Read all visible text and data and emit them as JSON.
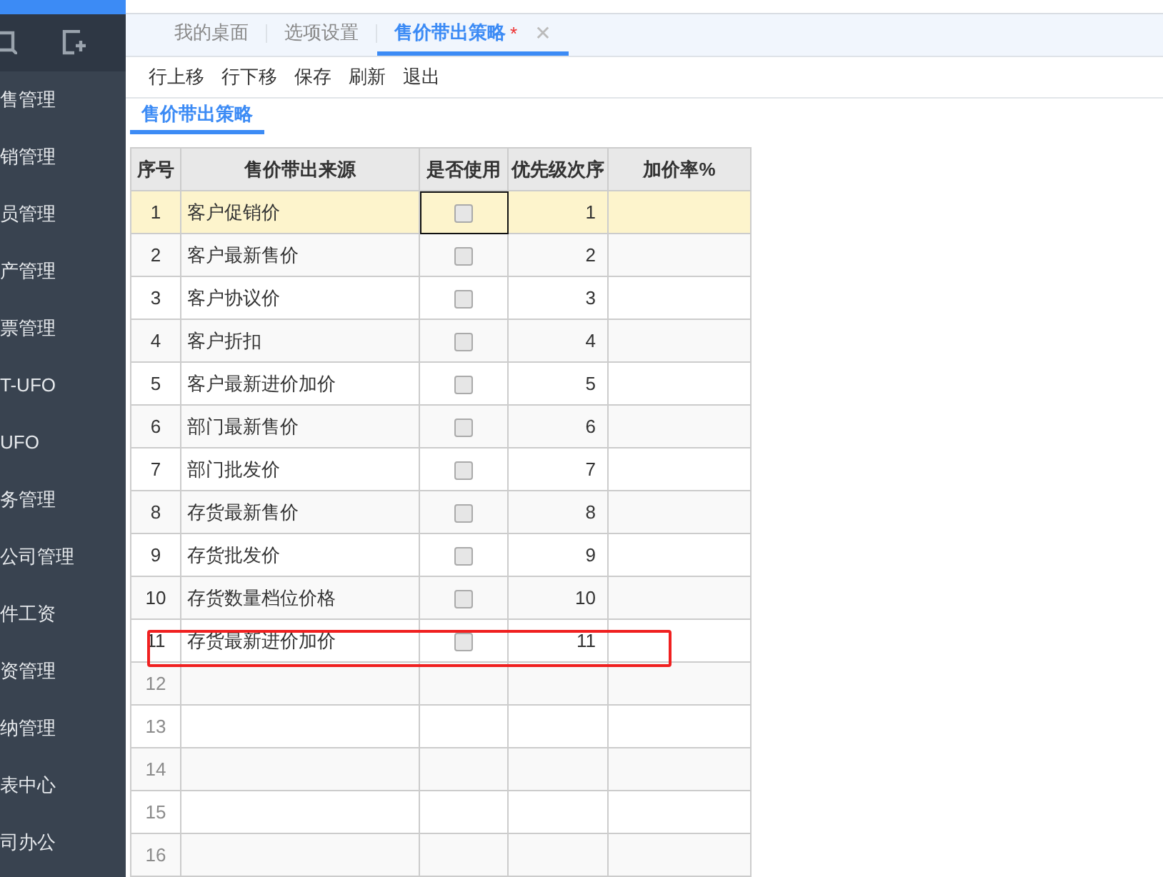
{
  "sidebar": {
    "items": [
      {
        "label": "售管理"
      },
      {
        "label": "销管理"
      },
      {
        "label": "员管理"
      },
      {
        "label": "产管理"
      },
      {
        "label": "票管理"
      },
      {
        "label": "T-UFO"
      },
      {
        "label": "UFO"
      },
      {
        "label": "务管理"
      },
      {
        "label": "公司管理"
      },
      {
        "label": "件工资"
      },
      {
        "label": "资管理"
      },
      {
        "label": "纳管理"
      },
      {
        "label": "表中心"
      },
      {
        "label": "司办公"
      }
    ]
  },
  "tabs": [
    {
      "label": "我的桌面",
      "selected": false,
      "modified": false,
      "closable": false
    },
    {
      "label": "选项设置",
      "selected": false,
      "modified": false,
      "closable": false
    },
    {
      "label": "售价带出策略",
      "selected": true,
      "modified": true,
      "modified_mark": "*",
      "closable": true,
      "close_glyph": "✕"
    }
  ],
  "toolbar": [
    "行上移",
    "行下移",
    "保存",
    "刷新",
    "退出"
  ],
  "section_tab": {
    "label": "售价带出策略"
  },
  "table": {
    "columns": [
      "序号",
      "售价带出来源",
      "是否使用",
      "优先级次序",
      "加价率%"
    ],
    "rows": [
      {
        "kind": "data",
        "no": "1",
        "source": "客户促销价",
        "used": false,
        "priority": "1",
        "selected": true,
        "highlighted": false
      },
      {
        "kind": "data",
        "no": "2",
        "source": "客户最新售价",
        "used": false,
        "priority": "2",
        "selected": false,
        "highlighted": false
      },
      {
        "kind": "data",
        "no": "3",
        "source": "客户协议价",
        "used": false,
        "priority": "3",
        "selected": false,
        "highlighted": false
      },
      {
        "kind": "data",
        "no": "4",
        "source": "客户折扣",
        "used": false,
        "priority": "4",
        "selected": false,
        "highlighted": false
      },
      {
        "kind": "data",
        "no": "5",
        "source": "客户最新进价加价",
        "used": false,
        "priority": "5",
        "selected": false,
        "highlighted": false
      },
      {
        "kind": "data",
        "no": "6",
        "source": "部门最新售价",
        "used": false,
        "priority": "6",
        "selected": false,
        "highlighted": false
      },
      {
        "kind": "data",
        "no": "7",
        "source": "部门批发价",
        "used": false,
        "priority": "7",
        "selected": false,
        "highlighted": false
      },
      {
        "kind": "data",
        "no": "8",
        "source": "存货最新售价",
        "used": false,
        "priority": "8",
        "selected": false,
        "highlighted": false
      },
      {
        "kind": "data",
        "no": "9",
        "source": "存货批发价",
        "used": false,
        "priority": "9",
        "selected": false,
        "highlighted": false
      },
      {
        "kind": "data",
        "no": "10",
        "source": "存货数量档位价格",
        "used": false,
        "priority": "10",
        "selected": false,
        "highlighted": false
      },
      {
        "kind": "data",
        "no": "11",
        "source": "存货最新进价加价",
        "used": false,
        "priority": "11",
        "selected": false,
        "highlighted": true
      },
      {
        "kind": "empty",
        "no": "12"
      },
      {
        "kind": "empty",
        "no": "13"
      },
      {
        "kind": "empty",
        "no": "14"
      },
      {
        "kind": "empty",
        "no": "15"
      },
      {
        "kind": "empty",
        "no": "16"
      }
    ]
  }
}
